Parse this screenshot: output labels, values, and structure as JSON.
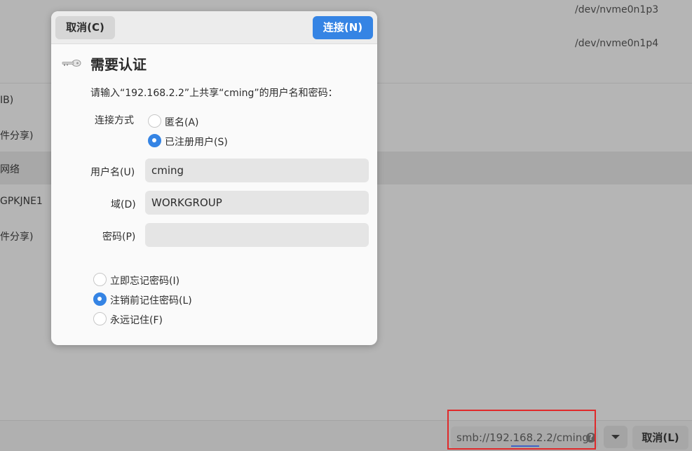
{
  "background": {
    "device_paths": [
      "/dev/nvme0n1p3",
      "/dev/nvme0n1p4"
    ],
    "sidebar_fragments": [
      "IB)",
      "件分享)",
      "网络",
      "GPKJNE1",
      "件分享)"
    ]
  },
  "dialog": {
    "cancel_label": "取消(C)",
    "connect_label": "连接(N)",
    "title": "需要认证",
    "description": "请输入“192.168.2.2”上共享“cming”的用户名和密码：",
    "connect_method_label": "连接方式",
    "radio_anonymous": "匿名(A)",
    "radio_registered": "已注册用户(S)",
    "username_label": "用户名(U)",
    "username_value": "cming",
    "domain_label": "域(D)",
    "domain_value": "WORKGROUP",
    "password_label": "密码(P)",
    "password_value": "",
    "remember_forget": "立即忘记密码(I)",
    "remember_until_logout": "注销前记住密码(L)",
    "remember_forever": "永远记住(F)",
    "connect_method_selected": "已注册用户(S)",
    "remember_selected": "注销前记住密码(L)"
  },
  "bottom_bar": {
    "url_value": "smb://192.168.2.2/cming",
    "help_glyph": "?",
    "cancel_label": "取消(L)"
  },
  "colors": {
    "accent": "#3584e4",
    "highlight_box": "#e0292a"
  }
}
